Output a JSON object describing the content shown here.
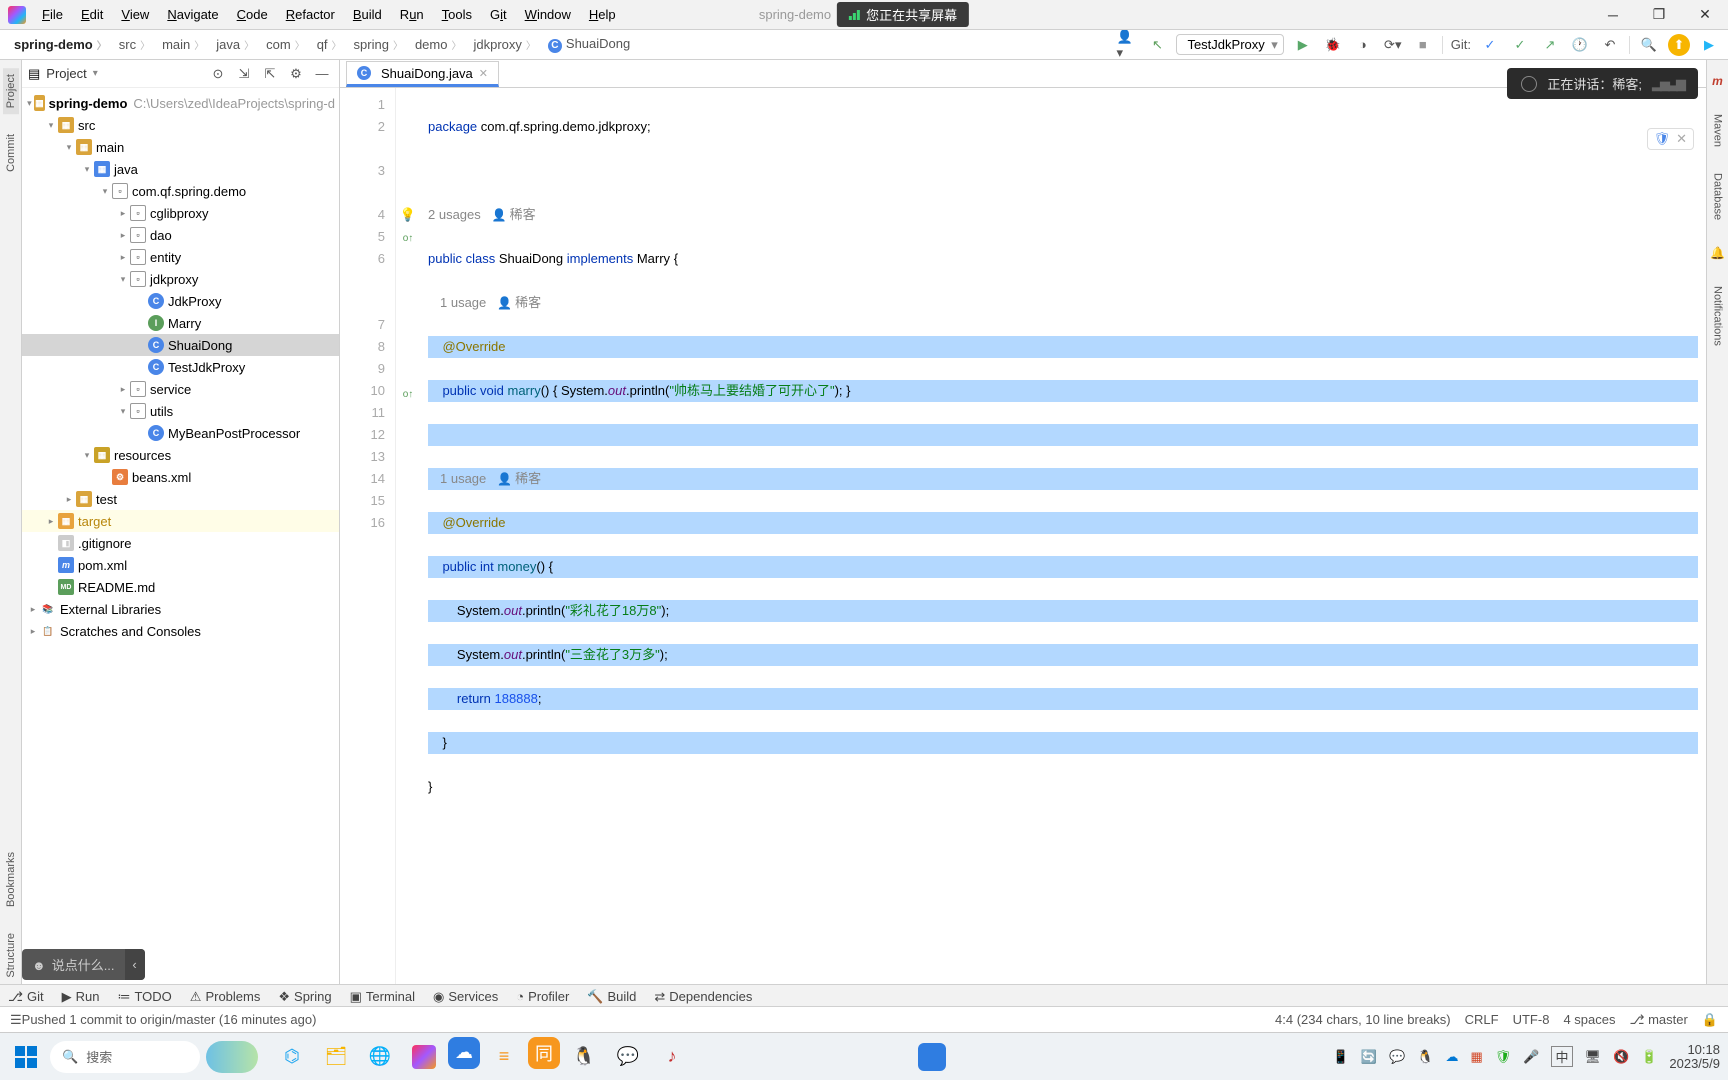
{
  "menu": {
    "file": "File",
    "edit": "Edit",
    "view": "View",
    "navigate": "Navigate",
    "code": "Code",
    "refactor": "Refactor",
    "build": "Build",
    "run": "Run",
    "tools": "Tools",
    "git": "Git",
    "window": "Window",
    "help": "Help"
  },
  "title_left": "spring-demo",
  "share_banner": "您正在共享屏幕",
  "breadcrumb": [
    "spring-demo",
    "src",
    "main",
    "java",
    "com",
    "qf",
    "spring",
    "demo",
    "jdkproxy",
    "ShuaiDong"
  ],
  "run_config": "TestJdkProxy",
  "git_label": "Git:",
  "project_pane": {
    "title": "Project",
    "root": "spring-demo",
    "root_path": "C:\\Users\\zed\\IdeaProjects\\spring-d",
    "tree": {
      "src": "src",
      "main": "main",
      "java": "java",
      "pkg": "com.qf.spring.demo",
      "cglibproxy": "cglibproxy",
      "dao": "dao",
      "entity": "entity",
      "jdkproxy": "jdkproxy",
      "JdkProxy": "JdkProxy",
      "Marry": "Marry",
      "ShuaiDong": "ShuaiDong",
      "TestJdkProxy": "TestJdkProxy",
      "service": "service",
      "utils": "utils",
      "MyBeanPostProcessor": "MyBeanPostProcessor",
      "resources": "resources",
      "beans": "beans.xml",
      "test": "test",
      "target": "target",
      "gitignore": ".gitignore",
      "pom": "pom.xml",
      "readme": "README.md",
      "ext": "External Libraries",
      "scratch": "Scratches and Consoles"
    }
  },
  "editor_tab": "ShuaiDong.java",
  "code": {
    "package_kw": "package",
    "package_val": " com.qf.spring.demo.jdkproxy;",
    "usages2": "2 usages   ",
    "author": "稀客",
    "public": "public ",
    "class": "class ",
    "clsname": "ShuaiDong ",
    "implements": "implements ",
    "iface": "Marry ",
    "brace_open": "{",
    "usage1": "1 usage   ",
    "override": "@Override",
    "void": "void ",
    "marry": "marry",
    "marry_body": "() { System.",
    "out": "out",
    "println": ".println(",
    "str1": "\"帅栋马上要结婚了可开心了\"",
    "end1": "); }",
    "int": "int ",
    "money": "money",
    "money_open": "() {",
    "sys": "System.",
    "str2": "\"彩礼花了18万8\"",
    "end2": ");",
    "str3": "\"三金花了3万多\"",
    "return": "return ",
    "num": "188888",
    "semi": ";",
    "brace_close": "}"
  },
  "line_numbers": [
    "1",
    "2",
    "",
    "3",
    "",
    "4",
    "5",
    "6",
    "",
    "",
    "7",
    "8",
    "9",
    "10",
    "11",
    "12",
    "13",
    "14",
    "15",
    "16"
  ],
  "speaking_overlay": "正在讲话：稀客;",
  "chat_placeholder": "说点什么...",
  "left_tabs": {
    "project": "Project",
    "commit": "Commit",
    "bookmarks": "Bookmarks",
    "structure": "Structure"
  },
  "right_tabs": {
    "maven": "Maven",
    "database": "Database",
    "notifications": "Notifications"
  },
  "bottom_tabs": {
    "git": "Git",
    "run": "Run",
    "todo": "TODO",
    "problems": "Problems",
    "spring": "Spring",
    "terminal": "Terminal",
    "services": "Services",
    "profiler": "Profiler",
    "build": "Build",
    "dependencies": "Dependencies"
  },
  "status": {
    "left": "Pushed 1 commit to origin/master (16 minutes ago)",
    "pos": "4:4 (234 chars, 10 line breaks)",
    "eol": "CRLF",
    "enc": "UTF-8",
    "indent": "4 spaces",
    "branch": "master"
  },
  "taskbar": {
    "search": "搜索",
    "clock_time": "10:18",
    "clock_date": "2023/5/9",
    "ime": "中"
  }
}
